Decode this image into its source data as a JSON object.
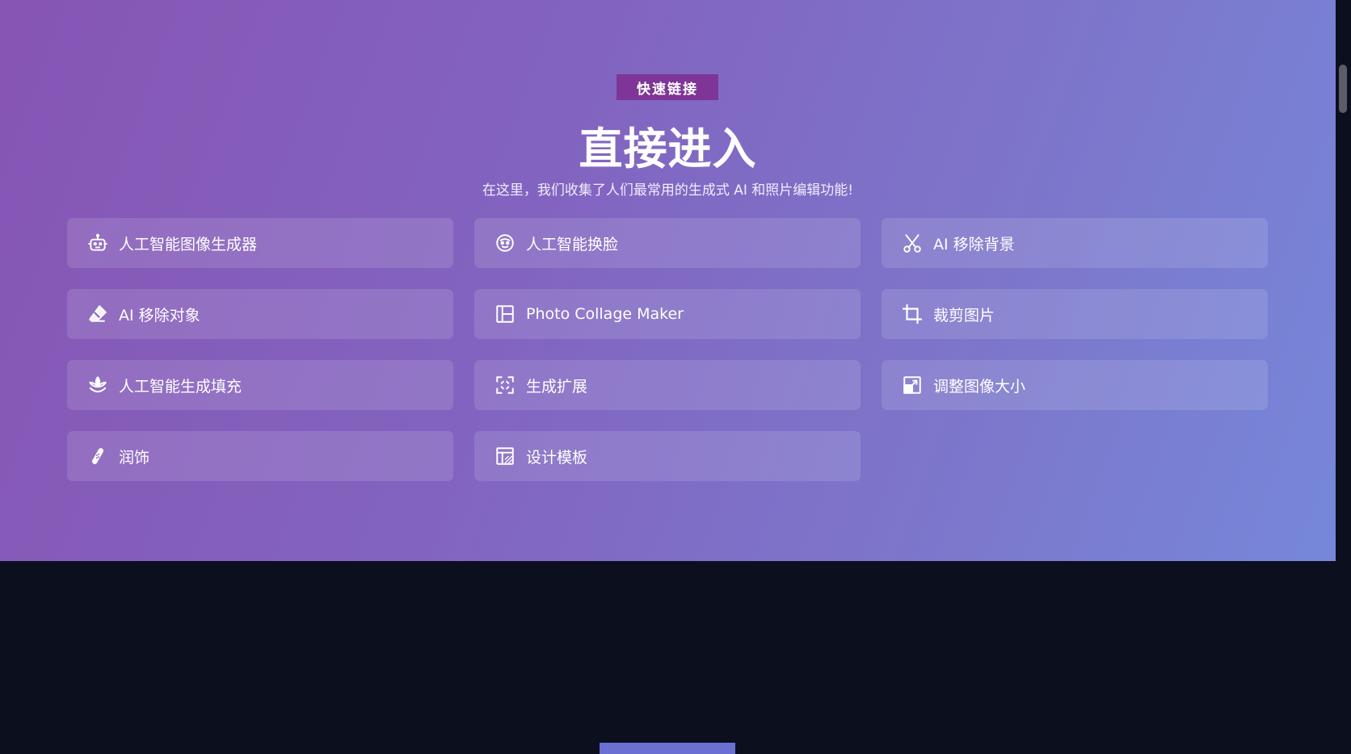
{
  "hero": {
    "badge": "快速链接",
    "title": "直接进入",
    "subtitle": "在这里，我们收集了人们最常用的生成式 AI 和照片编辑功能!"
  },
  "links": [
    {
      "label": "人工智能图像生成器",
      "icon": "robot-icon"
    },
    {
      "label": "人工智能换脸",
      "icon": "face-icon"
    },
    {
      "label": "AI 移除背景",
      "icon": "scissors-icon"
    },
    {
      "label": "AI 移除对象",
      "icon": "eraser-icon"
    },
    {
      "label": "Photo Collage Maker",
      "icon": "collage-icon"
    },
    {
      "label": "裁剪图片",
      "icon": "crop-icon"
    },
    {
      "label": "人工智能生成填充",
      "icon": "lotus-icon"
    },
    {
      "label": "生成扩展",
      "icon": "expand-icon"
    },
    {
      "label": "调整图像大小",
      "icon": "resize-icon"
    },
    {
      "label": "润饰",
      "icon": "bandage-icon"
    },
    {
      "label": "设计模板",
      "icon": "template-icon"
    }
  ],
  "colors": {
    "badge_bg": "#7e3597",
    "hero_gradient_start": "#8755b4",
    "hero_gradient_end": "#7687da",
    "page_bg": "#0b0f1e",
    "bottom_button": "#6a6fd1"
  }
}
